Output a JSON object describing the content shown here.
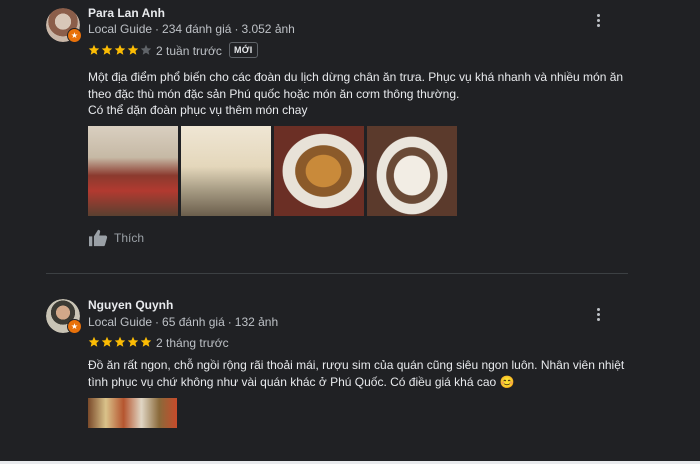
{
  "reviews": [
    {
      "name": "Para Lan Anh",
      "guide": "Local Guide",
      "reviews_count": "234 đánh giá",
      "photos_count": "3.052 ảnh",
      "rating": 4,
      "when": "2 tuần trước",
      "new_label": "MỚI",
      "text": [
        "Một địa điểm phổ biến cho các đoàn du lịch dừng chân ăn trưa. Phục vụ khá nhanh và nhiều món ăn",
        "theo đặc thù món đặc sản Phú quốc hoặc món ăn cơm thông thường.",
        "Có thể dặn đoàn phục vụ thêm món chay"
      ],
      "like_label": "Thích"
    },
    {
      "name": "Nguyen Quynh",
      "guide": "Local Guide",
      "reviews_count": "65 đánh giá",
      "photos_count": "132 ảnh",
      "rating": 5,
      "when": "2 tháng trước",
      "text": [
        "Đồ ăn rất ngon, chỗ ngồi rộng rãi thoải mái, rượu sim của quán cũng siêu ngon luôn. Nhân viên nhiệt",
        "tình phục vụ chứ không như vài quán khác ở Phú Quốc. Có điều giá khá cao 😊"
      ]
    }
  ],
  "colors": {
    "background": "#202124",
    "star_filled": "#fbbc04",
    "star_empty": "#5f6368",
    "guide_badge": "#e8710a"
  },
  "icons": [
    "more-vert-icon",
    "star-icon",
    "thumb-up-icon",
    "local-guide-badge-icon"
  ]
}
